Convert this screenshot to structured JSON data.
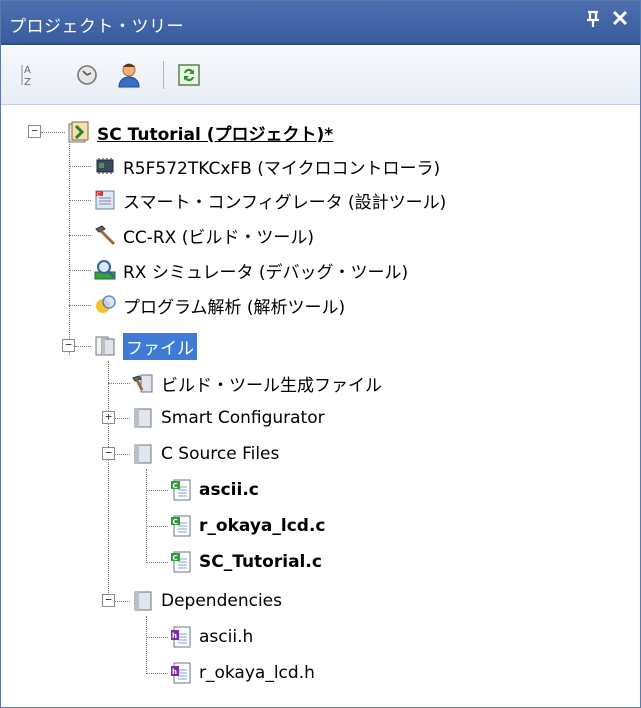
{
  "panel": {
    "title": "プロジェクト・ツリー",
    "pin_glyph": "ᵖ",
    "close_glyph": "×"
  },
  "toolbar": {
    "buttons": [
      {
        "name": "sort-az-icon"
      },
      {
        "name": "clock-icon"
      },
      {
        "name": "user-icon"
      },
      {
        "name": "refresh-icon"
      }
    ]
  },
  "tree": {
    "project": "SC Tutorial (プロジェクト)*",
    "mcu": "R5F572TKCxFB (マイクロコントローラ)",
    "smart_config_tool": "スマート・コンフィグレータ (設計ツール)",
    "build_tool": "CC-RX (ビルド・ツール)",
    "debug_tool": "RX シミュレータ (デバッグ・ツール)",
    "analysis_tool": "プログラム解析 (解析ツール)",
    "files": "ファイル",
    "build_generated": "ビルド・ツール生成ファイル",
    "smart_configurator": "Smart Configurator",
    "c_source_files": "C Source Files",
    "ascii_c": "ascii.c",
    "r_okaya_lcd_c": "r_okaya_lcd.c",
    "sc_tutorial_c": "SC_Tutorial.c",
    "dependencies": "Dependencies",
    "ascii_h": "ascii.h",
    "r_okaya_lcd_h": "r_okaya_lcd.h"
  },
  "colors": {
    "title_bar": "#3e61a6",
    "selection": "#3d7bd6",
    "folder": "#d9dde3",
    "c_file_accent": "#2f9e3a",
    "h_file_accent": "#7a2f9e"
  }
}
